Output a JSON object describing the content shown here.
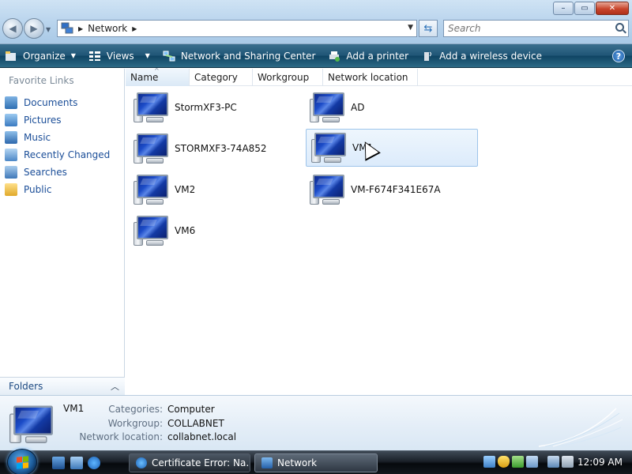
{
  "window": {
    "minimize_glyph": "–",
    "maximize_glyph": "▭",
    "close_glyph": "✕"
  },
  "address": {
    "location": "Network",
    "search_placeholder": "Search"
  },
  "toolbar": {
    "organize": "Organize",
    "views": "Views",
    "network_sharing": "Network and Sharing Center",
    "add_printer": "Add a printer",
    "add_wireless": "Add a wireless device",
    "help": "?"
  },
  "sidebar": {
    "title": "Favorite Links",
    "items": [
      {
        "label": "Documents",
        "icon": "documents-icon"
      },
      {
        "label": "Pictures",
        "icon": "pictures-icon"
      },
      {
        "label": "Music",
        "icon": "music-icon"
      },
      {
        "label": "Recently Changed",
        "icon": "recent-icon"
      },
      {
        "label": "Searches",
        "icon": "searches-icon"
      },
      {
        "label": "Public",
        "icon": "folder-icon"
      }
    ],
    "folders_label": "Folders"
  },
  "columns": [
    "Name",
    "Category",
    "Workgroup",
    "Network location"
  ],
  "computers": [
    {
      "name": "StormXF3-PC"
    },
    {
      "name": "AD"
    },
    {
      "name": "STORMXF3-74A852"
    },
    {
      "name": "VM1",
      "selected": true
    },
    {
      "name": "VM2"
    },
    {
      "name": "VM-F674F341E67A"
    },
    {
      "name": "VM6"
    }
  ],
  "details": {
    "name": "VM1",
    "labels": [
      "Categories:",
      "Workgroup:",
      "Network location:"
    ],
    "values": [
      "Computer",
      "COLLABNET",
      "collabnet.local"
    ]
  },
  "taskbar": {
    "tasks": [
      {
        "label": "Certificate Error: Na...",
        "active": false
      },
      {
        "label": "Network",
        "active": true
      }
    ],
    "clock": "12:09 AM"
  },
  "colors": {
    "link": "#1b4e98",
    "selection_border": "#9dc4ea",
    "command_bar": "#1f5576"
  }
}
